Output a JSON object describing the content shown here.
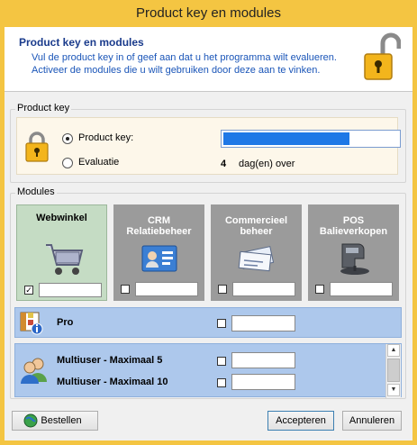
{
  "window": {
    "title": "Product key en modules"
  },
  "header": {
    "title": "Product key en modules",
    "desc_line1": "Vul de product key in of geef aan dat u het programma wilt evalueren.",
    "desc_line2": "Activeer de modules die u wilt gebruiken door deze aan te vinken.",
    "icon": "padlock-open-icon"
  },
  "product_key": {
    "group_label": "Product key",
    "option_key_label": "Product key:",
    "option_key_selected": true,
    "key_value": "",
    "option_eval_label": "Evaluatie",
    "eval_days": "4",
    "eval_days_suffix": "dag(en) over",
    "icon": "padlock-icon"
  },
  "modules": {
    "group_label": "Modules",
    "tiles": [
      {
        "label": "Webwinkel",
        "checked": true,
        "icon": "shopping-cart-icon"
      },
      {
        "label_line1": "CRM",
        "label_line2": "Relatiebeheer",
        "checked": false,
        "icon": "contact-card-icon"
      },
      {
        "label_line1": "Commercieel",
        "label_line2": "beheer",
        "checked": false,
        "icon": "cheque-icon"
      },
      {
        "label_line1": "POS",
        "label_line2": "Balieverkopen",
        "checked": false,
        "icon": "card-reader-icon"
      }
    ],
    "pro": {
      "label": "Pro",
      "checked": false,
      "icon": "grid-info-icon"
    },
    "multiuser": [
      {
        "label": "Multiuser - Maximaal 5",
        "checked": false
      },
      {
        "label": "Multiuser - Maximaal 10",
        "checked": false
      }
    ],
    "multiuser_icon": "users-icon"
  },
  "buttons": {
    "order": "Bestellen",
    "order_icon": "globe-icon",
    "accept": "Accepteren",
    "cancel": "Annuleren"
  }
}
